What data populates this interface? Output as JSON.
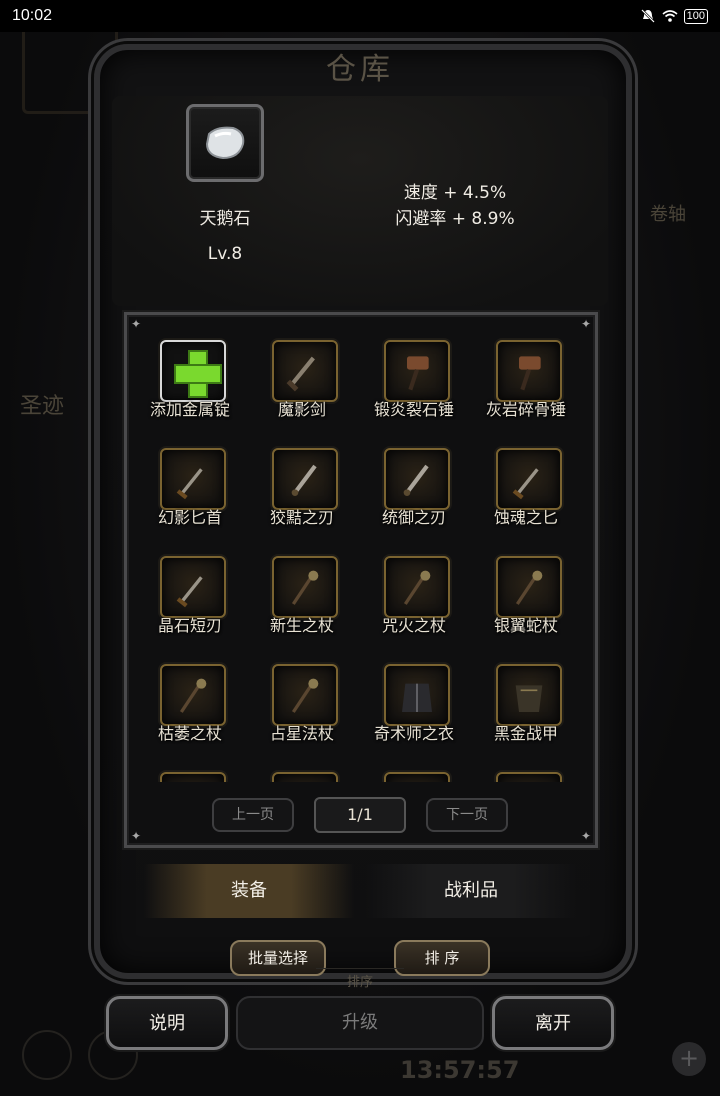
{
  "status_bar": {
    "time": "10:02",
    "battery": "100"
  },
  "background": {
    "left_text": "圣迹",
    "right_text": "卷轴",
    "timer": "13:57:57",
    "plus": "+"
  },
  "panel": {
    "title": "仓库"
  },
  "item": {
    "name": "天鹅石",
    "level": "Lv.8",
    "stats": [
      "速度 + 4.5%",
      "闪避率 + 8.9%"
    ]
  },
  "grid": {
    "items": [
      {
        "label": "添加金属锭",
        "icon": "plus-icon"
      },
      {
        "label": "魔影剑",
        "icon": "sword-icon"
      },
      {
        "label": "锻炎裂石锤",
        "icon": "hammer-icon"
      },
      {
        "label": "灰岩碎骨锤",
        "icon": "hammer-icon"
      },
      {
        "label": "幻影匕首",
        "icon": "dagger-icon"
      },
      {
        "label": "狡黠之刃",
        "icon": "blade-icon"
      },
      {
        "label": "统御之刃",
        "icon": "blade-icon"
      },
      {
        "label": "蚀魂之匕",
        "icon": "dagger-icon"
      },
      {
        "label": "晶石短刃",
        "icon": "dagger-icon"
      },
      {
        "label": "新生之杖",
        "icon": "staff-icon"
      },
      {
        "label": "咒火之杖",
        "icon": "staff-icon"
      },
      {
        "label": "银翼蛇杖",
        "icon": "staff-icon"
      },
      {
        "label": "枯萎之杖",
        "icon": "staff-icon"
      },
      {
        "label": "占星法杖",
        "icon": "staff-icon"
      },
      {
        "label": "奇术师之衣",
        "icon": "robe-icon"
      },
      {
        "label": "黑金战甲",
        "icon": "armor-icon"
      },
      {
        "label": "",
        "icon": "item-icon"
      },
      {
        "label": "",
        "icon": "item-icon"
      },
      {
        "label": "",
        "icon": "item-icon"
      },
      {
        "label": "",
        "icon": "item-icon"
      }
    ]
  },
  "pagination": {
    "prev": "上一页",
    "indicator": "1/1",
    "next": "下一页"
  },
  "tabs": {
    "equipment": "装备",
    "loot": "战利品"
  },
  "actions": {
    "batch_select": "批量选择",
    "sort": "排 序",
    "sort_bg": "排序",
    "help": "说明",
    "upgrade": "升级",
    "leave": "离开"
  },
  "colors": {
    "frame_gold": "#7a6330",
    "plus_green": "#7ad92e",
    "tab_active": "#4a3c24"
  }
}
